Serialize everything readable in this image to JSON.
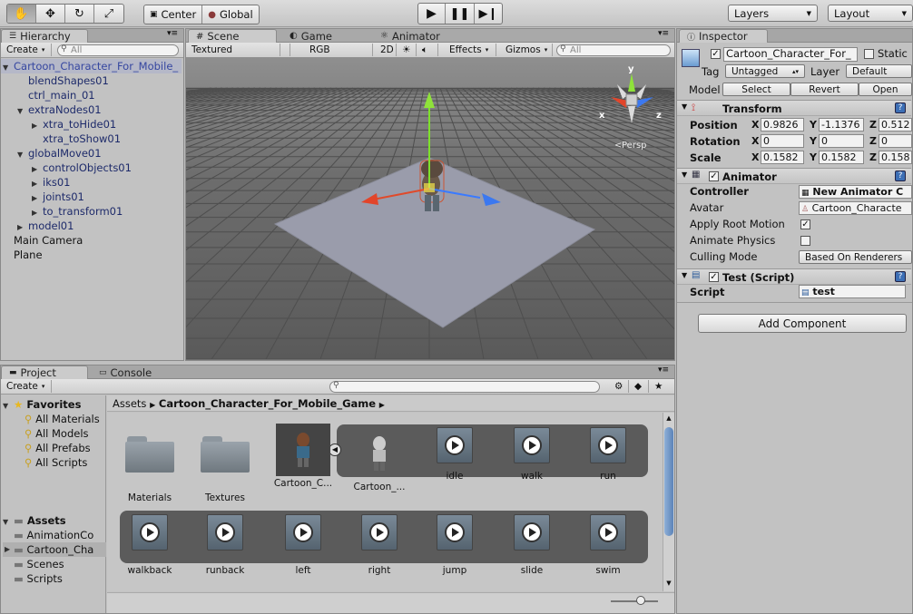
{
  "toolbar": {
    "center_label": "Center",
    "global_label": "Global",
    "layers_label": "Layers",
    "layout_label": "Layout"
  },
  "hierarchy": {
    "tab": "Hierarchy",
    "create_label": "Create",
    "search_placeholder": "All",
    "items": [
      {
        "label": "Cartoon_Character_For_Mobile_",
        "depth": 0,
        "arrow": "down",
        "selected": true
      },
      {
        "label": "blendShapes01",
        "depth": 1,
        "arrow": "none"
      },
      {
        "label": "ctrl_main_01",
        "depth": 1,
        "arrow": "none"
      },
      {
        "label": "extraNodes01",
        "depth": 1,
        "arrow": "down"
      },
      {
        "label": "xtra_toHide01",
        "depth": 2,
        "arrow": "right"
      },
      {
        "label": "xtra_toShow01",
        "depth": 2,
        "arrow": "none"
      },
      {
        "label": "globalMove01",
        "depth": 1,
        "arrow": "down"
      },
      {
        "label": "controlObjects01",
        "depth": 2,
        "arrow": "right"
      },
      {
        "label": "iks01",
        "depth": 2,
        "arrow": "right"
      },
      {
        "label": "joints01",
        "depth": 2,
        "arrow": "right"
      },
      {
        "label": "to_transform01",
        "depth": 2,
        "arrow": "right"
      },
      {
        "label": "model01",
        "depth": 1,
        "arrow": "right"
      },
      {
        "label": "Main Camera",
        "depth": 0,
        "arrow": "none",
        "plain": true
      },
      {
        "label": "Plane",
        "depth": 0,
        "arrow": "none",
        "plain": true
      }
    ]
  },
  "scene": {
    "tabs": [
      "Scene",
      "Game",
      "Animator"
    ],
    "textured_label": "Textured",
    "rgb_label": "RGB",
    "mode_2d": "2D",
    "effects_label": "Effects",
    "gizmos_label": "Gizmos",
    "search_placeholder": "All",
    "persp_label": "Persp",
    "axis_y": "y",
    "axis_x": "x",
    "axis_z": "z"
  },
  "inspector": {
    "tab": "Inspector",
    "object_name": "Cartoon_Character_For_",
    "static_label": "Static",
    "tag_label": "Tag",
    "tag_value": "Untagged",
    "layer_label": "Layer",
    "layer_value": "Default",
    "model_label": "Model",
    "select_btn": "Select",
    "revert_btn": "Revert",
    "open_btn": "Open",
    "transform": {
      "title": "Transform",
      "position_label": "Position",
      "rotation_label": "Rotation",
      "scale_label": "Scale",
      "position": {
        "x": "0.9826",
        "y": "-1.1376",
        "z": "0.512"
      },
      "rotation": {
        "x": "0",
        "y": "0",
        "z": "0"
      },
      "scale": {
        "x": "0.1582",
        "y": "0.1582",
        "z": "0.158"
      }
    },
    "axes": {
      "x": "X",
      "y": "Y",
      "z": "Z"
    },
    "animator": {
      "title": "Animator",
      "controller_label": "Controller",
      "controller_value": "New Animator C",
      "avatar_label": "Avatar",
      "avatar_value": "Cartoon_Characte",
      "apply_root_motion_label": "Apply Root Motion",
      "animate_physics_label": "Animate Physics",
      "culling_mode_label": "Culling Mode",
      "culling_mode_value": "Based On Renderers"
    },
    "script_component": {
      "title": "Test (Script)",
      "script_label": "Script",
      "script_value": "test"
    },
    "add_component_btn": "Add Component"
  },
  "project": {
    "tabs": [
      "Project",
      "Console"
    ],
    "create_label": "Create",
    "favorites_label": "Favorites",
    "favorites": [
      "All Materials",
      "All Models",
      "All Prefabs",
      "All Scripts"
    ],
    "assets_label": "Assets",
    "asset_folders": [
      "AnimationCo",
      "Cartoon_Cha",
      "Scenes",
      "Scripts"
    ],
    "breadcrumb_root": "Assets",
    "breadcrumb_current": "Cartoon_Character_For_Mobile_Game",
    "row1": [
      "Materials",
      "Textures",
      "Cartoon_C...",
      "Cartoon_...",
      "idle",
      "walk",
      "run"
    ],
    "row2": [
      "walkback",
      "runback",
      "left",
      "right",
      "jump",
      "slide",
      "swim"
    ]
  }
}
